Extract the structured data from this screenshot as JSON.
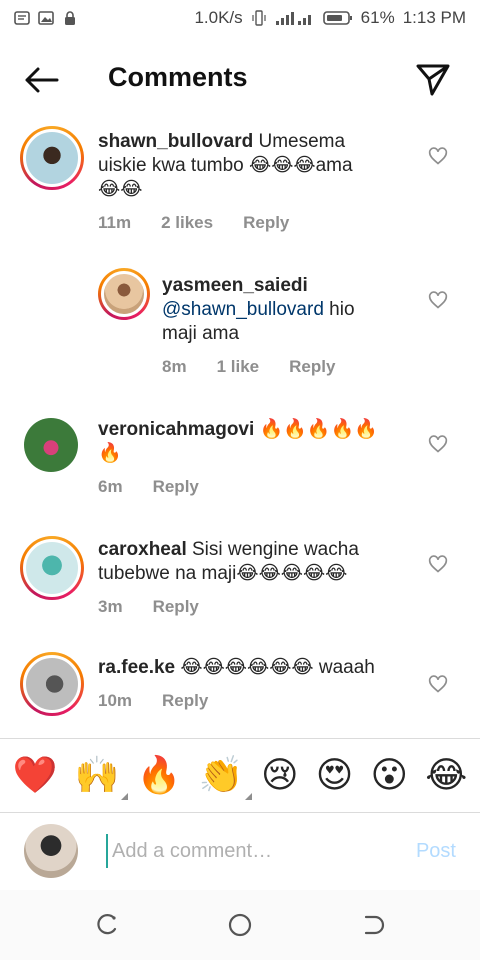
{
  "status_bar": {
    "network_speed": "1.0K/s",
    "battery": "61%",
    "time": "1:13 PM"
  },
  "header": {
    "title": "Comments"
  },
  "comments": [
    {
      "username": "shawn_bullovard",
      "text": "Umesema uiskie kwa tumbo 😂😂😂ama 😂😂",
      "line1": " Umesema",
      "line2": "uiskie kwa tumbo 😂😂😂ama",
      "line3": "😂😂",
      "time": "11m",
      "likes": "2 likes",
      "reply": "Reply"
    },
    {
      "username": "yasmeen_saiedi",
      "mention": "@shawn_bullovard",
      "line1_rest": " hio",
      "line2": "maji ama",
      "time": "8m",
      "likes": "1 like",
      "reply": "Reply"
    },
    {
      "username": "veronicahmagovi",
      "line1": " 🔥🔥🔥🔥🔥",
      "line2": "🔥",
      "time": "6m",
      "reply": "Reply"
    },
    {
      "username": "caroxheal",
      "line1": " Sisi wengine wacha",
      "line2": "tubebwe na maji😂😂😂😂😂",
      "time": "3m",
      "reply": "Reply"
    },
    {
      "username": "ra.fee.ke",
      "line1": " 😂😂😂😂😂😂 waaah",
      "time": "10m",
      "reply": "Reply"
    }
  ],
  "emoji_bar": [
    "❤️",
    "🙌",
    "🔥",
    "👏",
    "😢",
    "😍",
    "😮",
    "😂"
  ],
  "composer": {
    "placeholder": "Add a comment…",
    "post_label": "Post"
  },
  "colors": {
    "link": "#00376b",
    "meta": "#8e8e8e",
    "post_disabled": "#b3dbff"
  }
}
